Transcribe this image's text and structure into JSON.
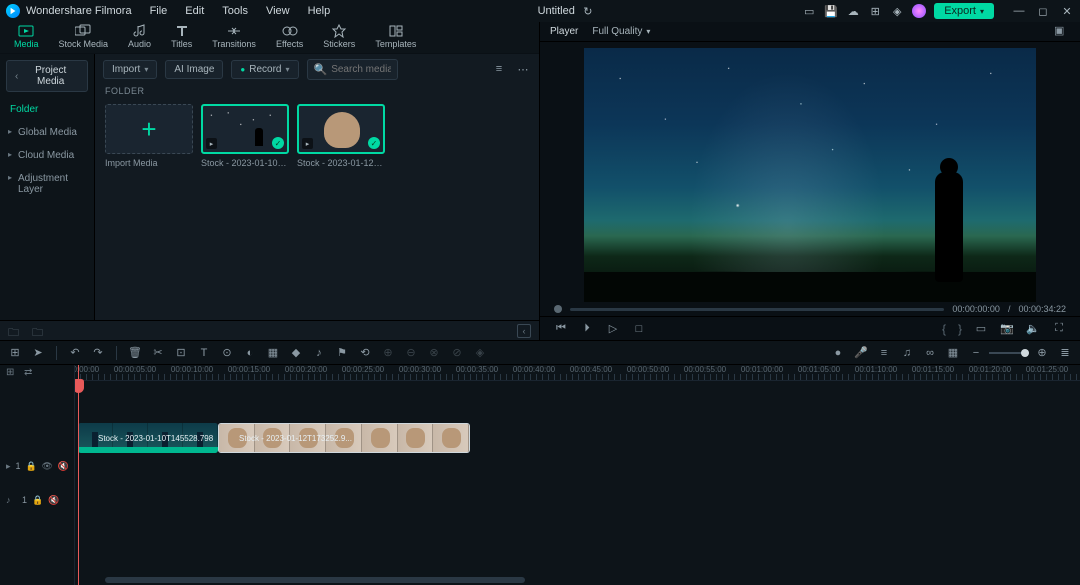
{
  "app": {
    "name": "Wondershare Filmora",
    "document": "Untitled"
  },
  "menu": [
    "File",
    "Edit",
    "Tools",
    "View",
    "Help"
  ],
  "export_btn": "Export",
  "category_tabs": [
    {
      "id": "media",
      "label": "Media"
    },
    {
      "id": "stock",
      "label": "Stock Media"
    },
    {
      "id": "audio",
      "label": "Audio"
    },
    {
      "id": "titles",
      "label": "Titles"
    },
    {
      "id": "transitions",
      "label": "Transitions"
    },
    {
      "id": "effects",
      "label": "Effects"
    },
    {
      "id": "stickers",
      "label": "Stickers"
    },
    {
      "id": "templates",
      "label": "Templates"
    }
  ],
  "sidebar": {
    "project_media_btn": "Project Media",
    "folder_header": "Folder",
    "items": [
      "Global Media",
      "Cloud Media",
      "Adjustment Layer"
    ]
  },
  "media_toolbar": {
    "import": "Import",
    "ai_image": "AI Image",
    "record": "Record",
    "search_placeholder": "Search media"
  },
  "folder_label": "FOLDER",
  "thumbs": {
    "import": "Import Media",
    "clip1": "Stock - 2023-01-10T145528.7...",
    "clip2": "Stock - 2023-01-12T173252.9..."
  },
  "player": {
    "tab": "Player",
    "quality": "Full Quality",
    "time_current": "00:00:00:00",
    "time_sep": "/",
    "time_total": "00:00:34:22"
  },
  "ruler": [
    "00:00:00:00",
    "00:00:05:00",
    "00:00:10:00",
    "00:00:15:00",
    "00:00:20:00",
    "00:00:25:00",
    "00:00:30:00",
    "00:00:35:00",
    "00:00:40:00",
    "00:00:45:00",
    "00:00:50:00",
    "00:00:55:00",
    "00:01:00:00",
    "00:01:05:00",
    "00:01:10:00",
    "00:01:15:00",
    "00:01:20:00",
    "00:01:25:00"
  ],
  "tracks": {
    "video": "1",
    "audio": "1",
    "clip1_name": "Stock - 2023-01-10T145528.798",
    "clip2_name": "Stock - 2023-01-12T173252.9..."
  }
}
